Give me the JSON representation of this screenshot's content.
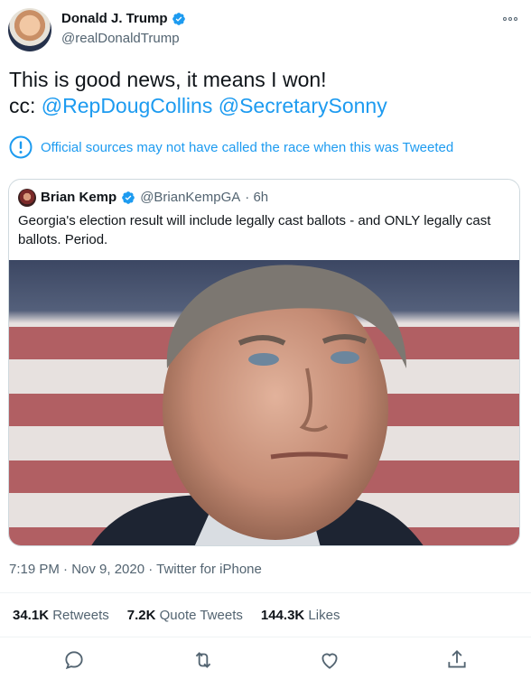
{
  "author": {
    "name": "Donald J. Trump",
    "handle": "@realDonaldTrump"
  },
  "tweet": {
    "line1": "This is good news, it means I won!",
    "cc_prefix": "cc: ",
    "mention1": "@RepDougCollins",
    "mention2": "@SecretarySonny"
  },
  "notice": {
    "text": "Official sources may not have called the race when this was Tweeted"
  },
  "quote": {
    "name": "Brian Kemp",
    "handle": "@BrianKempGA",
    "time": "· 6h",
    "text": "Georgia's election result will include legally cast ballots - and ONLY legally cast ballots. Period."
  },
  "meta": {
    "timestamp": "7:19 PM · Nov 9, 2020 · Twitter for iPhone"
  },
  "stats": {
    "retweets_count": "34.1K",
    "retweets_label": "Retweets",
    "quotes_count": "7.2K",
    "quotes_label": "Quote Tweets",
    "likes_count": "144.3K",
    "likes_label": "Likes"
  },
  "colors": {
    "link": "#1d9bf0",
    "secondary_text": "#536471",
    "border": "#cfd9de"
  },
  "icons": [
    "verified-badge-icon",
    "more-icon",
    "info-icon",
    "reply-icon",
    "retweet-icon",
    "like-icon",
    "share-icon"
  ]
}
